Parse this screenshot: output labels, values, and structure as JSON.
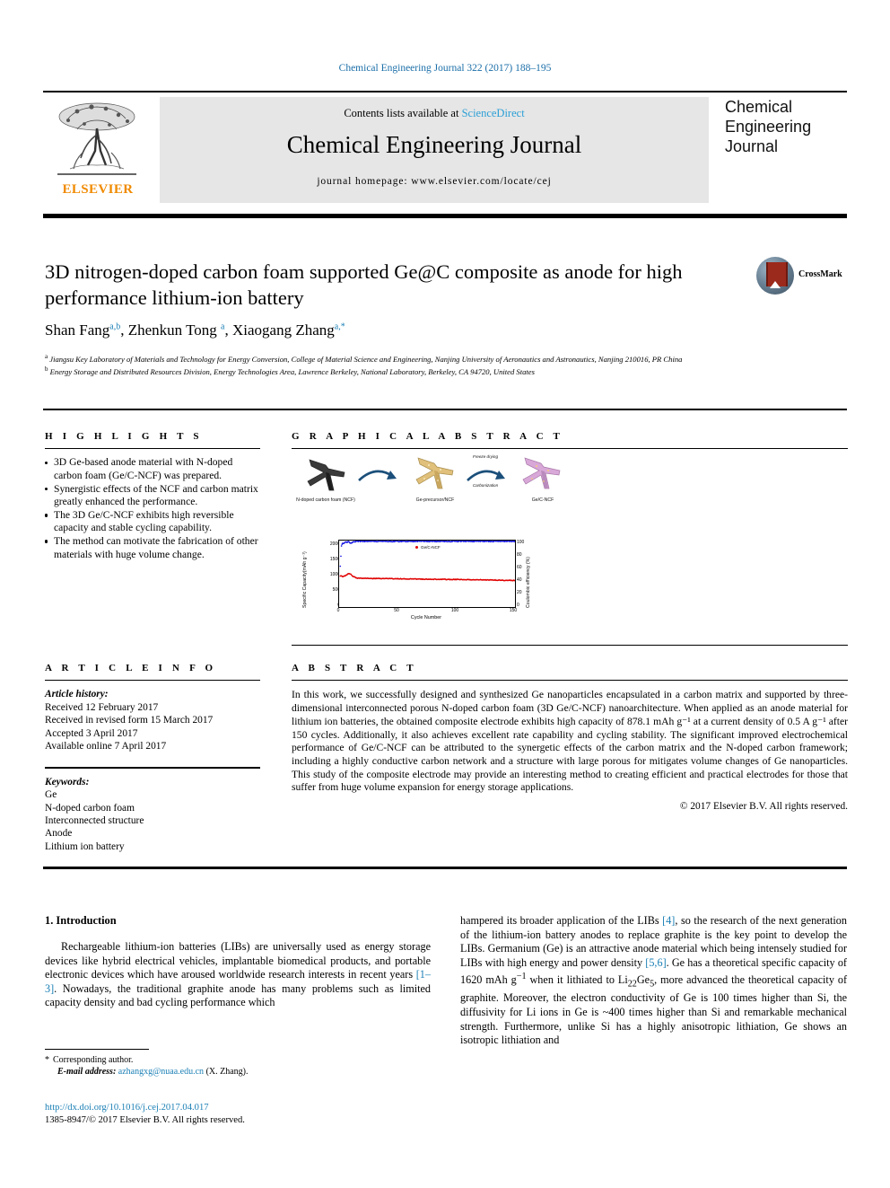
{
  "running_head": "Chemical Engineering Journal 322 (2017) 188–195",
  "masthead": {
    "contents_text": "Contents lists available at ",
    "sciencedirect": "ScienceDirect",
    "journal_title": "Chemical Engineering Journal",
    "homepage": "journal homepage: www.elsevier.com/locate/cej",
    "publisher": "ELSEVIER",
    "cover_lines": [
      "Chemical",
      "Engineering",
      "Journal"
    ]
  },
  "article": {
    "title": "3D nitrogen-doped carbon foam supported Ge@C composite as anode for high performance lithium-ion battery",
    "crossmark_label": "CrossMark",
    "authors_html": "Shan Fang<sup>a,b</sup>, Zhenkun Tong <sup>a</sup>, Xiaogang Zhang<sup>a,*</sup>",
    "affiliations": [
      "Jiangsu Key Laboratory of Materials and Technology for Energy Conversion, College of Material Science and Engineering, Nanjing University of Aeronautics and Astronautics, Nanjing 210016, PR China",
      "Energy Storage and Distributed Resources Division, Energy Technologies Area, Lawrence Berkeley, National Laboratory, Berkeley, CA 94720, United States"
    ]
  },
  "highlights": {
    "heading": "H I G H L I G H T S",
    "items": [
      "3D Ge-based anode material with N-doped carbon foam (Ge/C-NCF) was prepared.",
      "Synergistic effects of the NCF and carbon matrix greatly enhanced the performance.",
      "The 3D Ge/C-NCF exhibits high reversible capacity and stable cycling capability.",
      "The method can motivate the fabrication of other materials with huge volume change."
    ]
  },
  "graphical_abstract": {
    "heading": "G R A P H I C A L   A B S T R A C T",
    "figure_labels": [
      "N-doped carbon foam (NCF)",
      "Ge-precursor/NCF",
      "Ge/C-NCF"
    ],
    "arrow_labels": [
      "Freeze drying",
      "Carbonization"
    ]
  },
  "chart_data": {
    "type": "scatter",
    "title": "",
    "xlabel": "Cycle Number",
    "ylabel": "Specific Capacity(mAh g⁻¹)",
    "y2label": "Coulombic efficiency (%)",
    "xlim": [
      0,
      150
    ],
    "ylim": [
      0,
      2200
    ],
    "y2lim": [
      0,
      100
    ],
    "xticks": [
      0,
      50,
      100,
      150
    ],
    "yticks": [
      0,
      500,
      1000,
      1500,
      2000
    ],
    "y2ticks": [
      0,
      20,
      40,
      60,
      80,
      100
    ],
    "grid": false,
    "legend": [
      {
        "name": "Ge/C-NCF",
        "color": "#e00000"
      }
    ],
    "series": [
      {
        "name": "Specific capacity (Ge/C-NCF)",
        "color": "#e00000",
        "axis": "left",
        "x": [
          1,
          3,
          5,
          8,
          10,
          12,
          15,
          20,
          25,
          30,
          40,
          50,
          60,
          70,
          80,
          90,
          100,
          110,
          120,
          130,
          140,
          150
        ],
        "y": [
          1030,
          1010,
          1040,
          1110,
          1090,
          1010,
          960,
          950,
          945,
          945,
          940,
          935,
          930,
          925,
          920,
          915,
          912,
          908,
          900,
          895,
          885,
          878
        ]
      },
      {
        "name": "Coulombic efficiency",
        "color": "#1414e0",
        "axis": "right",
        "x": [
          1,
          2,
          3,
          5,
          8,
          10,
          12,
          15,
          20,
          30,
          50,
          75,
          100,
          125,
          150
        ],
        "y": [
          61,
          92,
          96,
          97,
          98,
          96,
          98,
          99,
          99,
          99,
          99,
          99,
          99,
          99,
          99
        ]
      }
    ]
  },
  "article_info": {
    "heading": "A R T I C L E   I N F O",
    "history_label": "Article history:",
    "history": [
      "Received 12 February 2017",
      "Received in revised form 15 March 2017",
      "Accepted 3 April 2017",
      "Available online 7 April 2017"
    ],
    "keywords_label": "Keywords:",
    "keywords": [
      "Ge",
      "N-doped carbon foam",
      "Interconnected structure",
      "Anode",
      "Lithium ion battery"
    ]
  },
  "abstract": {
    "heading": "A B S T R A C T",
    "body": "In this work, we successfully designed and synthesized Ge nanoparticles encapsulated in a carbon matrix and supported by three-dimensional interconnected porous N-doped carbon foam (3D Ge/C-NCF) nanoarchitecture. When applied as an anode material for lithium ion batteries, the obtained composite electrode exhibits high capacity of 878.1 mAh g⁻¹ at a current density of 0.5 A g⁻¹ after 150 cycles. Additionally, it also achieves excellent rate capability and cycling stability. The significant improved electrochemical performance of Ge/C-NCF can be attributed to the synergetic effects of the carbon matrix and the N-doped carbon framework; including a highly conductive carbon network and a structure with large porous for mitigates volume changes of Ge nanoparticles. This study of the composite electrode may provide an interesting method to creating efficient and practical electrodes for those that suffer from huge volume expansion for energy storage applications.",
    "copyright": "© 2017 Elsevier B.V. All rights reserved."
  },
  "introduction": {
    "heading": "1. Introduction",
    "left_paragraph_pre": "Rechargeable lithium-ion batteries (LIBs) are universally used as energy storage devices like hybrid electrical vehicles, implantable biomedical products, and portable electronic devices which have aroused worldwide research interests in recent years ",
    "left_ref1": "[1–3]",
    "left_paragraph_post": ". Nowadays, the traditional graphite anode has many problems such as limited capacity density and bad cycling performance which",
    "right_pre": "hampered its broader application of the LIBs ",
    "right_ref1": "[4]",
    "right_mid1": ", so the research of the next generation of the lithium-ion battery anodes to replace graphite is the key point to develop the LIBs. Germanium (Ge) is an attractive anode material which being intensely studied for LIBs with high energy and power density ",
    "right_ref2": "[5,6]",
    "right_mid2": ". Ge has a theoretical specific capacity of 1620 mAh g",
    "right_sup1": "−1",
    "right_mid3": " when it lithiated to Li",
    "right_sub1": "22",
    "right_mid4": "Ge",
    "right_sub2": "5",
    "right_end": ", more advanced the theoretical capacity of graphite. Moreover, the electron conductivity of Ge is 100 times higher than Si, the diffusivity for Li ions in Ge is ~400 times higher than Si and remarkable mechanical strength. Furthermore, unlike Si has a highly anisotropic lithiation, Ge shows an isotropic lithiation and"
  },
  "footer": {
    "corresponding": "Corresponding author.",
    "email_label": "E-mail address:",
    "email": "azhangxg@nuaa.edu.cn",
    "email_suffix": "(X. Zhang).",
    "doi": "http://dx.doi.org/10.1016/j.cej.2017.04.017",
    "issn_line": "1385-8947/© 2017 Elsevier B.V. All rights reserved."
  },
  "colors": {
    "link": "#1a7fb5",
    "sciencedirect": "#2b9fd6",
    "elsevier_orange": "#f08a00",
    "capacity_red": "#e00000",
    "efficiency_blue": "#1414e0"
  }
}
